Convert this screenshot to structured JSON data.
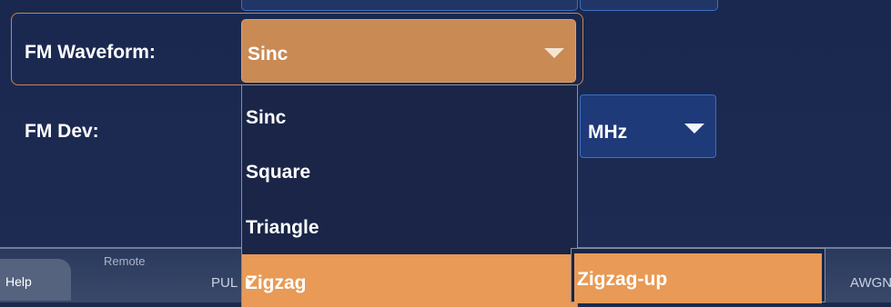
{
  "form": {
    "fm_waveform_label": "FM Waveform:",
    "fm_waveform_value": "Sinc",
    "fm_dev_label": "FM Dev:",
    "fm_dev_unit": "MHz"
  },
  "dropdown": {
    "items": [
      "Sinc",
      "Square",
      "Triangle",
      "Zigzag"
    ]
  },
  "submenu": {
    "items": [
      "Zigzag-up"
    ]
  },
  "bottom_tabs": {
    "help": "Help",
    "remote": "Remote",
    "pul": "PUL",
    "awgn": "AWGN"
  },
  "colors": {
    "highlight": "#e89a56",
    "combo": "#c98a54",
    "panel": "#1c2a4e",
    "accent_blue": "#3b6fc4"
  }
}
